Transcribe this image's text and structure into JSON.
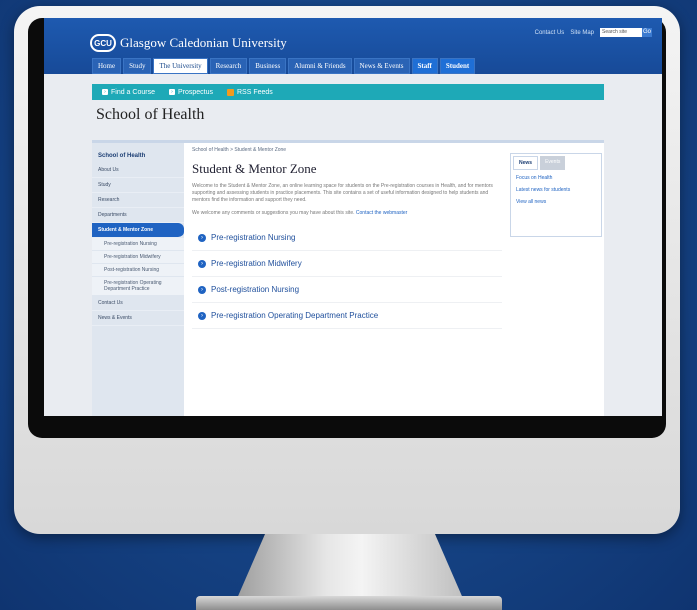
{
  "site": {
    "logo_badge": "GCU",
    "name": "Glasgow Caledonian University",
    "util_links": [
      "Contact Us",
      "Site Map"
    ],
    "search_placeholder": "Search site",
    "search_button": "Go"
  },
  "nav": {
    "items": [
      {
        "label": "Home"
      },
      {
        "label": "Study"
      },
      {
        "label": "The University"
      },
      {
        "label": "Research"
      },
      {
        "label": "Business"
      },
      {
        "label": "Alumni & Friends"
      },
      {
        "label": "News & Events"
      },
      {
        "label": "Staff"
      },
      {
        "label": "Student"
      }
    ]
  },
  "quicklinks": {
    "find_course": "Find a Course",
    "prospectus": "Prospectus",
    "rss": "RSS Feeds"
  },
  "page": {
    "title": "School of Health",
    "breadcrumb": "School of Health > Student & Mentor Zone",
    "heading": "Student & Mentor Zone",
    "para1": "Welcome to the Student & Mentor Zone, an online learning space for students on the Pre-registration courses in Health, and for mentors supporting and assessing students in practice placements. This site contains a set of useful information designed to help students and mentors find the information and support they need.",
    "para2": "We welcome any comments or suggestions you may have about this site.",
    "para2_link": "Contact the webmaster"
  },
  "sidebar": {
    "head": "School of Health",
    "items": [
      "About Us",
      "Study",
      "Research",
      "Departments"
    ],
    "active": "Student & Mentor Zone",
    "subitems": [
      "Pre-registration Nursing",
      "Pre-registration Midwifery",
      "Post-registration Nursing",
      "Pre-registration Operating Department Practice"
    ],
    "tail": [
      "Contact Us",
      "News & Events"
    ]
  },
  "zones": [
    "Pre-registration Nursing",
    "Pre-registration Midwifery",
    "Post-registration Nursing",
    "Pre-registration Operating Department Practice"
  ],
  "news": {
    "tab_news": "News",
    "tab_events": "Events",
    "items": [
      "Focus on Health",
      "Latest news for students",
      "View all news"
    ]
  }
}
